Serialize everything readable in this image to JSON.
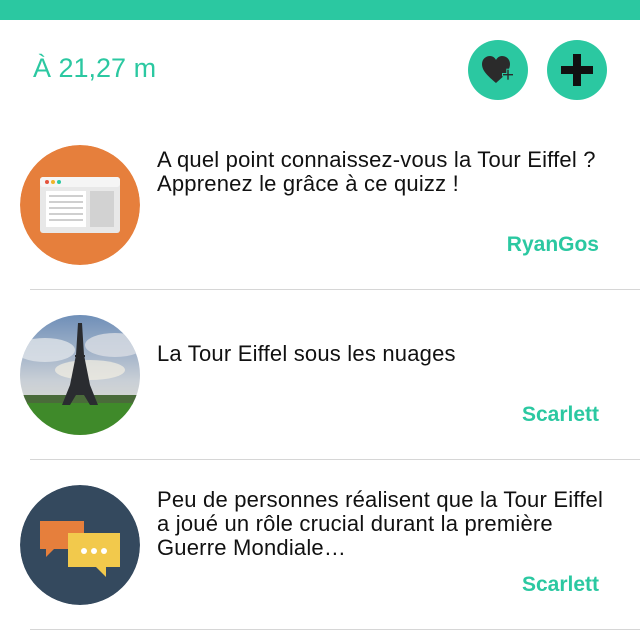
{
  "header": {
    "distance": "À 21,27 m",
    "favorite_icon": "heart-plus-icon",
    "add_icon": "plus-icon"
  },
  "colors": {
    "accent": "#2BC8A1",
    "divider": "#d6d6d6"
  },
  "items": [
    {
      "title": "A quel point connaissez-vous la Tour Eiffel ? Apprenez le grâce à ce quizz !",
      "author": "RyanGos",
      "thumbnail": "browser-window-icon"
    },
    {
      "title": "La Tour Eiffel sous les nuages",
      "author": "Scarlett",
      "thumbnail": "eiffel-tower-photo"
    },
    {
      "title": "Peu de personnes réalisent que la Tour Eiffel a joué un rôle crucial durant la première Guerre Mondiale…",
      "author": "Scarlett",
      "thumbnail": "chat-bubbles-icon"
    }
  ]
}
